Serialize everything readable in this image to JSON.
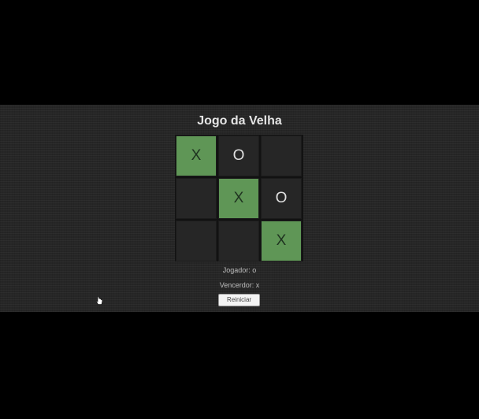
{
  "title": "Jogo da Velha",
  "board": {
    "cells": [
      {
        "mark": "X",
        "highlight": true
      },
      {
        "mark": "O",
        "highlight": false
      },
      {
        "mark": "",
        "highlight": false
      },
      {
        "mark": "",
        "highlight": false
      },
      {
        "mark": "X",
        "highlight": true
      },
      {
        "mark": "O",
        "highlight": false
      },
      {
        "mark": "",
        "highlight": false
      },
      {
        "mark": "",
        "highlight": false
      },
      {
        "mark": "X",
        "highlight": true
      }
    ]
  },
  "status": {
    "player": "Jogador: o",
    "winner": "Vencerdor: x"
  },
  "reset_label": "Reiniciar",
  "colors": {
    "background": "#262626",
    "win_cell": "#5f9656",
    "letterbox": "#000000"
  }
}
